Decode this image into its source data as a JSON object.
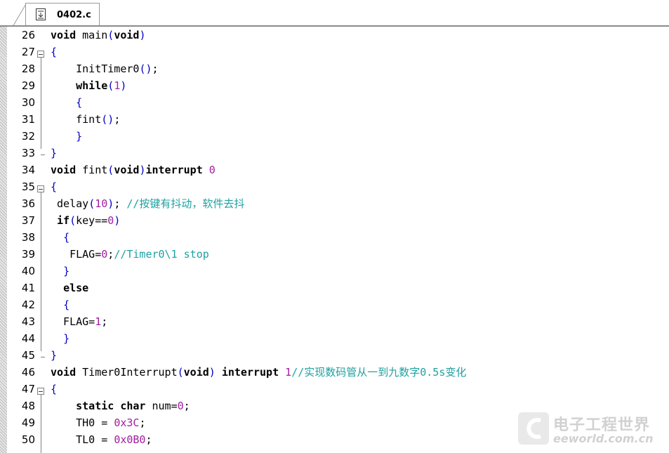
{
  "tab": {
    "label": "0402.c",
    "icon": "c-file-icon"
  },
  "colors": {
    "keyword": "#000000",
    "number": "#a020a0",
    "operator": "#0000c0",
    "comment": "#20a0a0",
    "line_number": "#000000"
  },
  "lines": [
    {
      "num": "26",
      "text": "void main(void)"
    },
    {
      "num": "27",
      "text": "{"
    },
    {
      "num": "28",
      "text": "    InitTimer0();"
    },
    {
      "num": "29",
      "text": "    while(1)"
    },
    {
      "num": "30",
      "text": "    {"
    },
    {
      "num": "31",
      "text": "    fint();"
    },
    {
      "num": "32",
      "text": "    }"
    },
    {
      "num": "33",
      "text": "}"
    },
    {
      "num": "34",
      "text": "void fint(void)interrupt 0"
    },
    {
      "num": "35",
      "text": "{"
    },
    {
      "num": "36",
      "text": " delay(10); //按键有抖动，软件去抖"
    },
    {
      "num": "37",
      "text": " if(key==0)"
    },
    {
      "num": "38",
      "text": "  {"
    },
    {
      "num": "39",
      "text": "   FLAG=0;//Timer0\\1 stop"
    },
    {
      "num": "40",
      "text": "  }"
    },
    {
      "num": "41",
      "text": "  else"
    },
    {
      "num": "42",
      "text": "  {"
    },
    {
      "num": "43",
      "text": "  FLAG=1;"
    },
    {
      "num": "44",
      "text": "  }"
    },
    {
      "num": "45",
      "text": "}"
    },
    {
      "num": "46",
      "text": "void Timer0Interrupt(void) interrupt 1//实现数码管从一到九数字0.5s变化"
    },
    {
      "num": "47",
      "text": "{"
    },
    {
      "num": "48",
      "text": "    static char num=0;"
    },
    {
      "num": "49",
      "text": "    TH0 = 0x3C;"
    },
    {
      "num": "50",
      "text": "    TL0 = 0x0B0;"
    }
  ],
  "watermark": {
    "cn": "电子工程世界",
    "en": "eeworld.com.cn",
    "icon": "eeworld-logo-icon"
  }
}
